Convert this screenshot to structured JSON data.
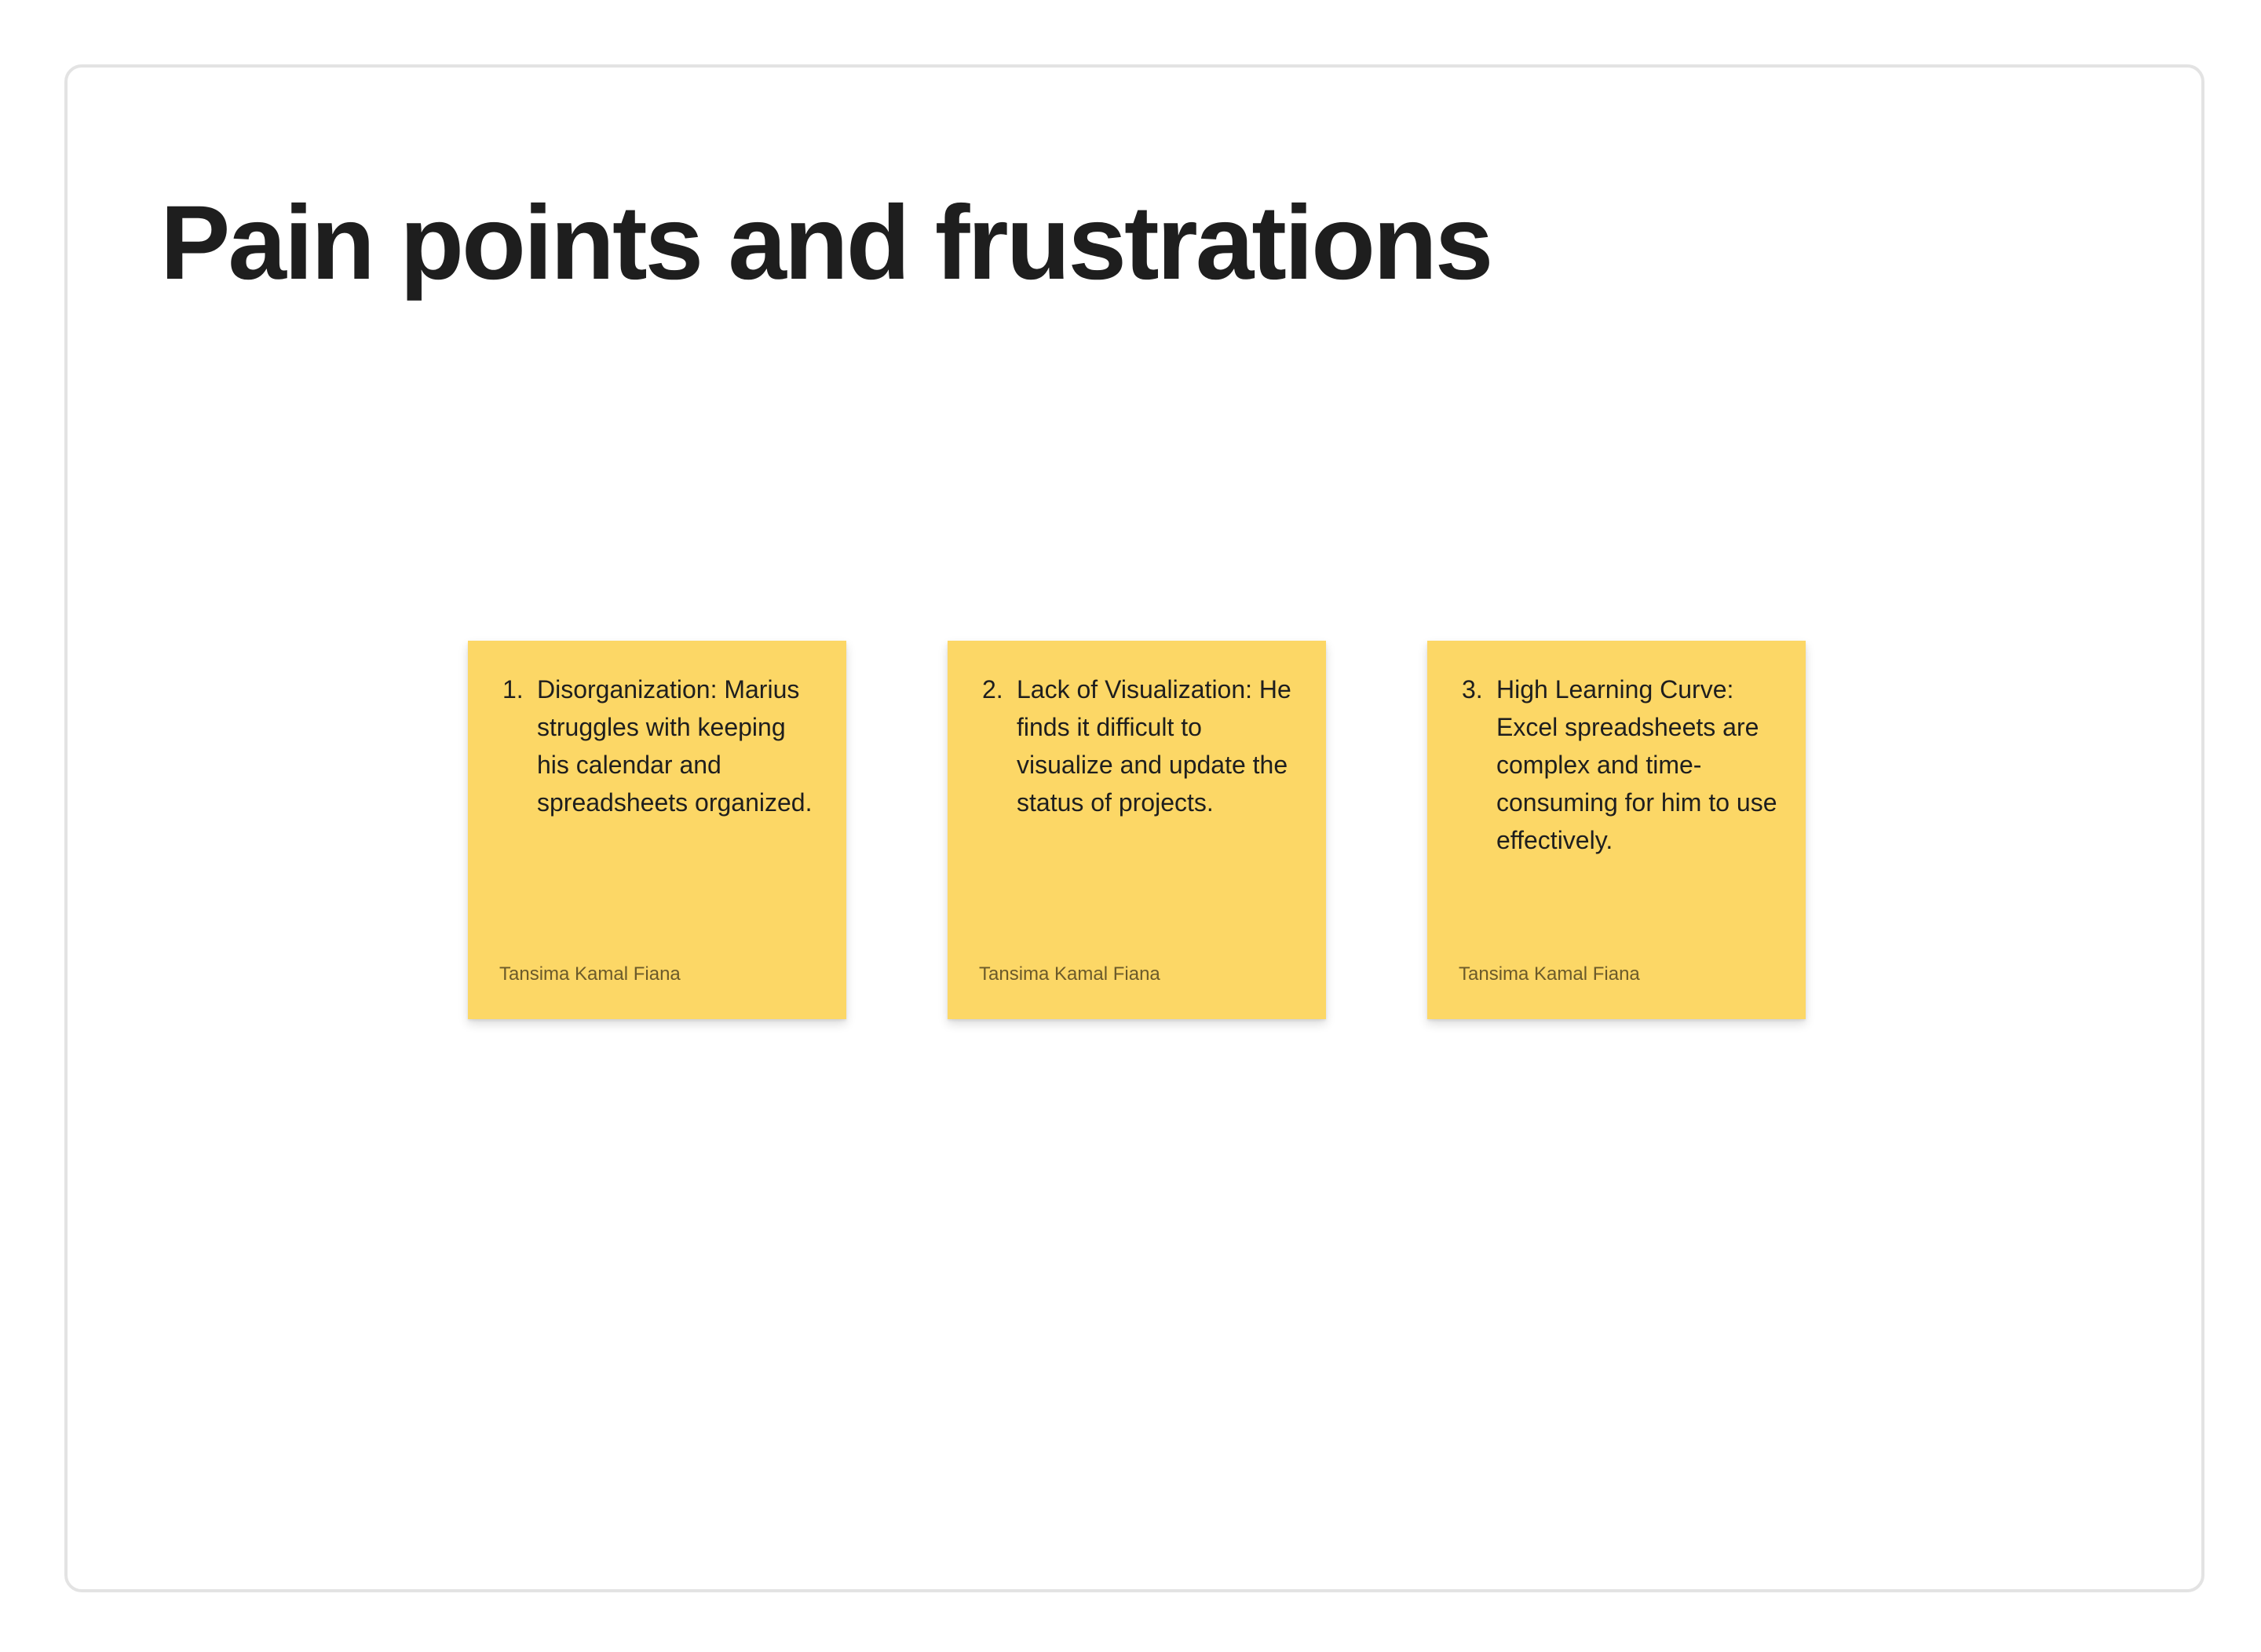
{
  "page": {
    "title": "Pain points and frustrations"
  },
  "notes": [
    {
      "number": "1.",
      "text": "Disorganization: Marius struggles with keeping his calendar and spreadsheets organized.",
      "author": "Tansima Kamal Fiana",
      "color": "#fcd766"
    },
    {
      "number": "2.",
      "text": "Lack of Visualization: He finds it difficult to visualize and update the status of projects.",
      "author": "Tansima Kamal Fiana",
      "color": "#fcd766"
    },
    {
      "number": "3.",
      "text": "High Learning Curve: Excel spreadsheets are complex and time-consuming for him to use effectively.",
      "author": "Tansima Kamal Fiana",
      "color": "#fcd766"
    }
  ]
}
